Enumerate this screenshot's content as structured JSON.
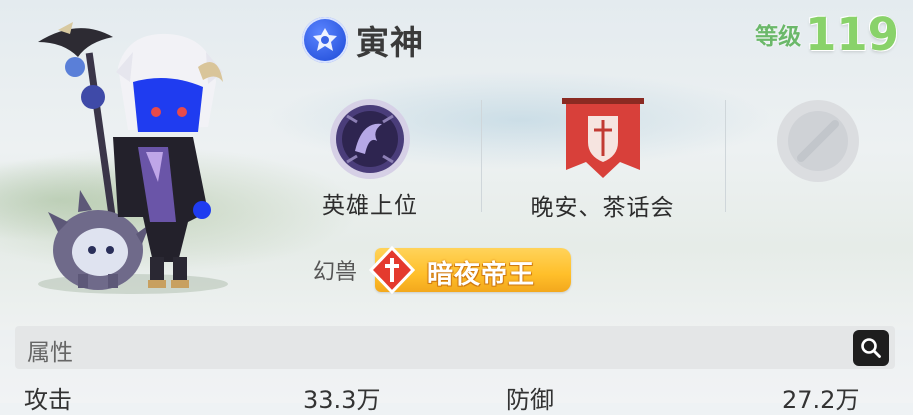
{
  "player": {
    "name": "寅神",
    "level_label": "等级",
    "level_value": "119"
  },
  "titles": [
    {
      "label": "英雄上位",
      "icon": "purple-dragon-emblem-icon"
    },
    {
      "label": "晚安、茶话会",
      "icon": "red-guild-banner-icon"
    },
    {
      "label": "",
      "icon": "empty-slot-icon"
    }
  ],
  "pet": {
    "label": "幻兽",
    "name": "暗夜帝王",
    "icon": "red-shield-sword-icon"
  },
  "attributes": {
    "title": "属性",
    "search_icon": "search-icon",
    "stats": [
      {
        "label": "攻击",
        "value": "33.3万"
      },
      {
        "label": "防御",
        "value": "27.2万"
      }
    ]
  },
  "colors": {
    "level": "#89d26a",
    "name_badge": "#2c58e0",
    "pet_tag": "#ffbf2a",
    "guild_banner": "#d8403a"
  }
}
